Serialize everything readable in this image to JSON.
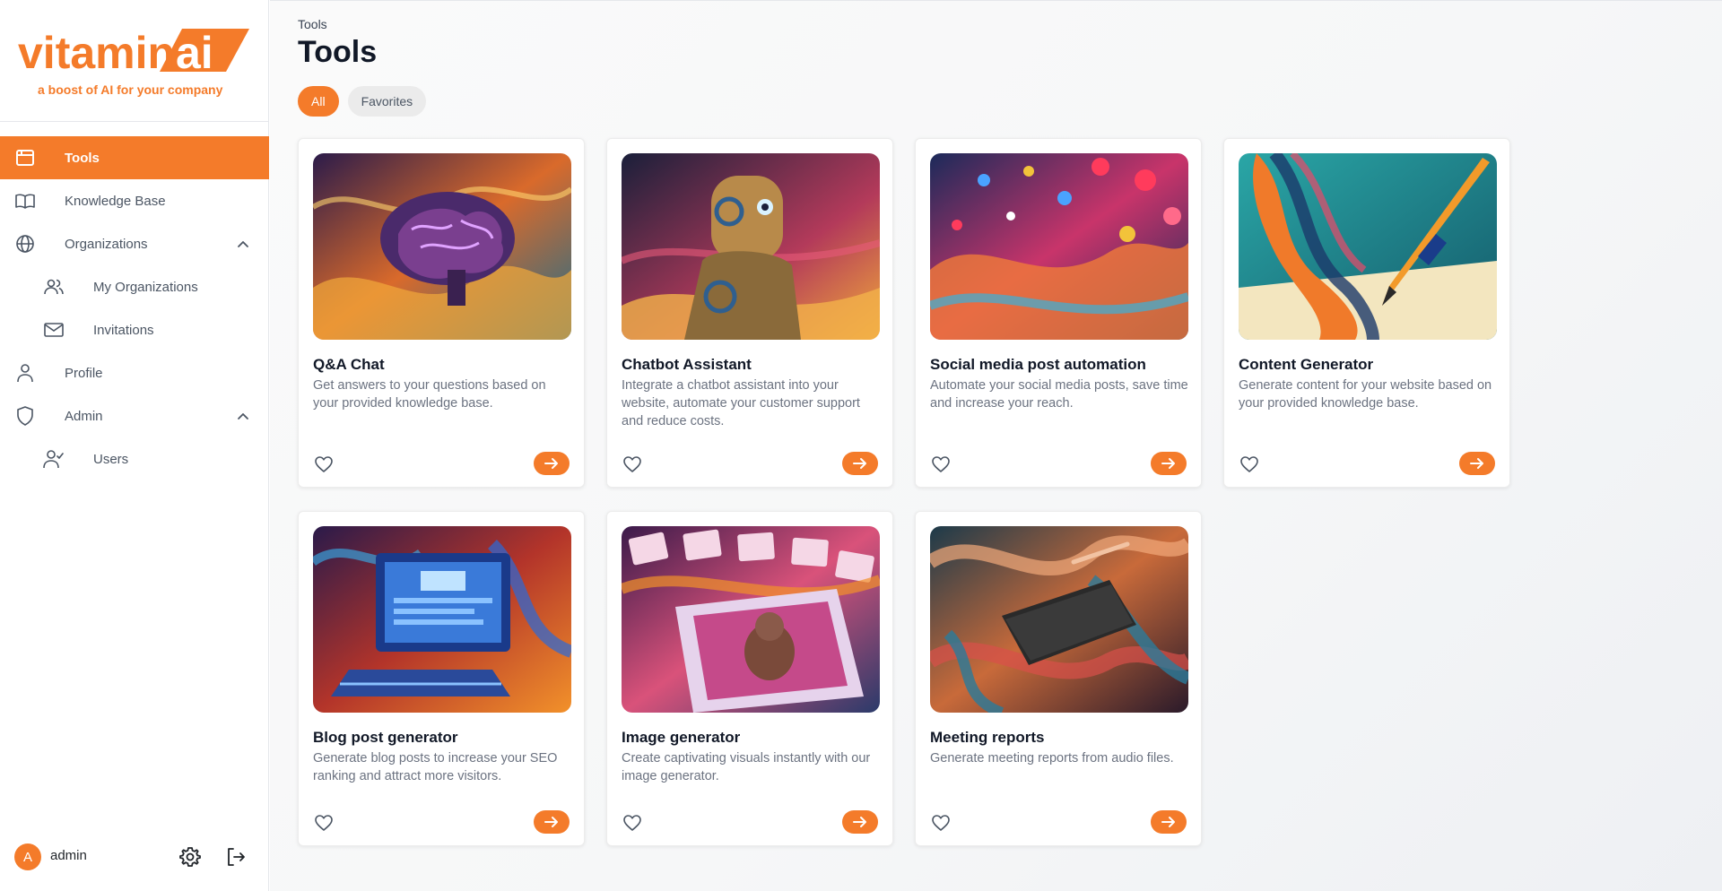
{
  "brand": {
    "name_part1": "vitamin",
    "name_part2": "ai",
    "tagline": "a boost of AI for your company",
    "accent_color": "#f47b2a"
  },
  "sidebar": {
    "items": [
      {
        "label": "Tools",
        "icon": "browser-window-icon",
        "active": true
      },
      {
        "label": "Knowledge Base",
        "icon": "book-open-icon"
      },
      {
        "label": "Organizations",
        "icon": "globe-icon",
        "expanded": true
      },
      {
        "label": "My Organizations",
        "icon": "users-icon"
      },
      {
        "label": "Invitations",
        "icon": "mail-icon"
      },
      {
        "label": "Profile",
        "icon": "user-icon"
      },
      {
        "label": "Admin",
        "icon": "shield-icon",
        "expanded": true
      },
      {
        "label": "Users",
        "icon": "user-check-icon"
      }
    ],
    "footer": {
      "avatar_initial": "A",
      "username": "admin",
      "settings_icon": "gear-icon",
      "logout_icon": "logout-icon"
    }
  },
  "header": {
    "breadcrumb": "Tools",
    "title": "Tools"
  },
  "filters": {
    "all": "All",
    "favorites": "Favorites",
    "selected": "All"
  },
  "tools": [
    {
      "title": "Q&A Chat",
      "description": "Get answers to your questions based on your provided knowledge base."
    },
    {
      "title": "Chatbot Assistant",
      "description": "Integrate a chatbot assistant into your website, automate your customer support and reduce costs."
    },
    {
      "title": "Social media post automation",
      "description": "Automate your social media posts, save time and increase your reach."
    },
    {
      "title": "Content Generator",
      "description": "Generate content for your website based on your provided knowledge base."
    },
    {
      "title": "Blog post generator",
      "description": "Generate blog posts to increase your SEO ranking and attract more visitors."
    },
    {
      "title": "Image generator",
      "description": "Create captivating visuals instantly with our image generator."
    },
    {
      "title": "Meeting reports",
      "description": "Generate meeting reports from audio files."
    }
  ]
}
